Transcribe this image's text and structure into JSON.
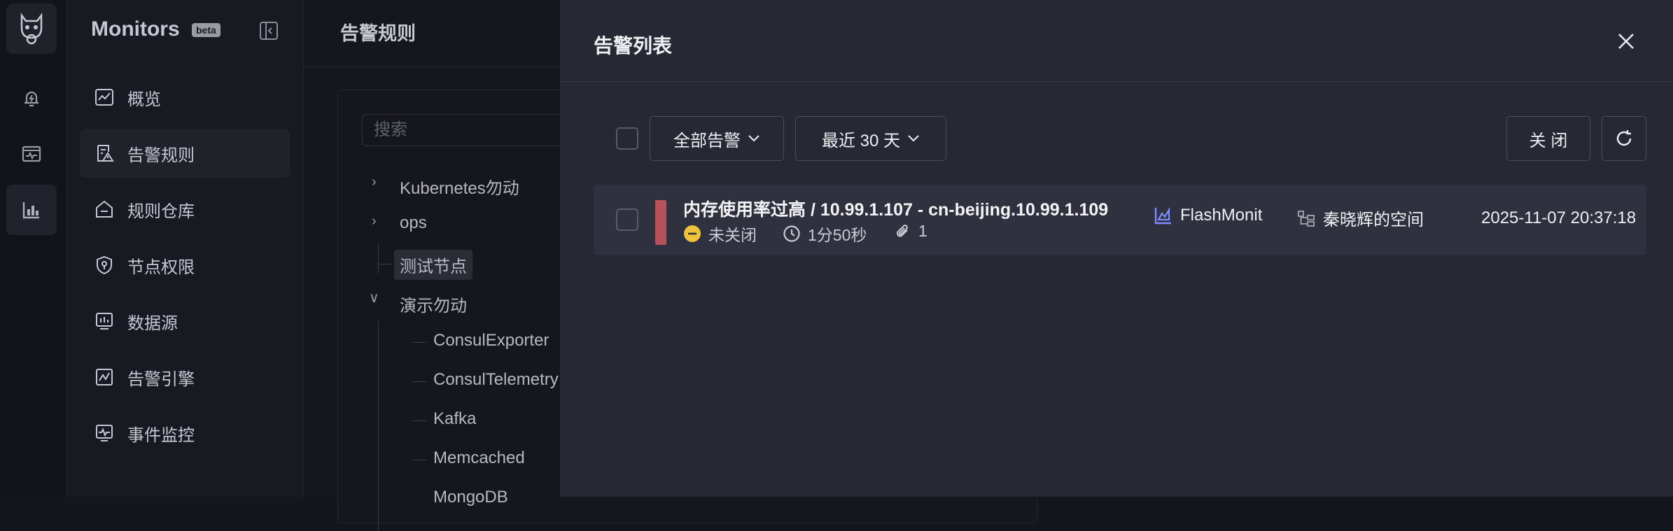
{
  "rail": {
    "icons": [
      "app-logo",
      "alert-bell-icon",
      "monitor-panel-icon",
      "chart-icon"
    ]
  },
  "sidebar": {
    "brand": "Monitors",
    "badge": "beta",
    "items": [
      {
        "label": "概览",
        "icon": "overview-chart-icon"
      },
      {
        "label": "告警规则",
        "icon": "alert-rule-icon"
      },
      {
        "label": "规则仓库",
        "icon": "rule-repo-icon"
      },
      {
        "label": "节点权限",
        "icon": "node-permission-icon"
      },
      {
        "label": "数据源",
        "icon": "datasource-icon"
      },
      {
        "label": "告警引擎",
        "icon": "alert-engine-icon"
      },
      {
        "label": "事件监控",
        "icon": "event-monitor-icon"
      }
    ]
  },
  "main": {
    "title": "告警规则",
    "search_placeholder": "搜索",
    "tree": {
      "n1": "Kubernetes勿动",
      "n2": "ops",
      "n3": "测试节点",
      "n4": "演示勿动",
      "c1": "ConsulExporter",
      "c2": "ConsulTelemetry",
      "c3": "Kafka",
      "c4": "Memcached",
      "c5": "MongoDB"
    }
  },
  "drawer": {
    "title": "告警列表",
    "filter_all": "全部告警",
    "filter_range": "最近 30 天",
    "close_label": "关 闭",
    "alert": {
      "title": "内存使用率过高 / 10.99.1.107 - cn-beijing.10.99.1.109",
      "status": "未关闭",
      "duration": "1分50秒",
      "attachments": "1",
      "source": "FlashMonit",
      "space": "秦晓辉的空间",
      "time": "2025-11-07 20:37:18"
    }
  },
  "colors": {
    "severity": "#b8515a",
    "status_dot": "#f0c23a",
    "source_icon": "#7f8cff"
  }
}
